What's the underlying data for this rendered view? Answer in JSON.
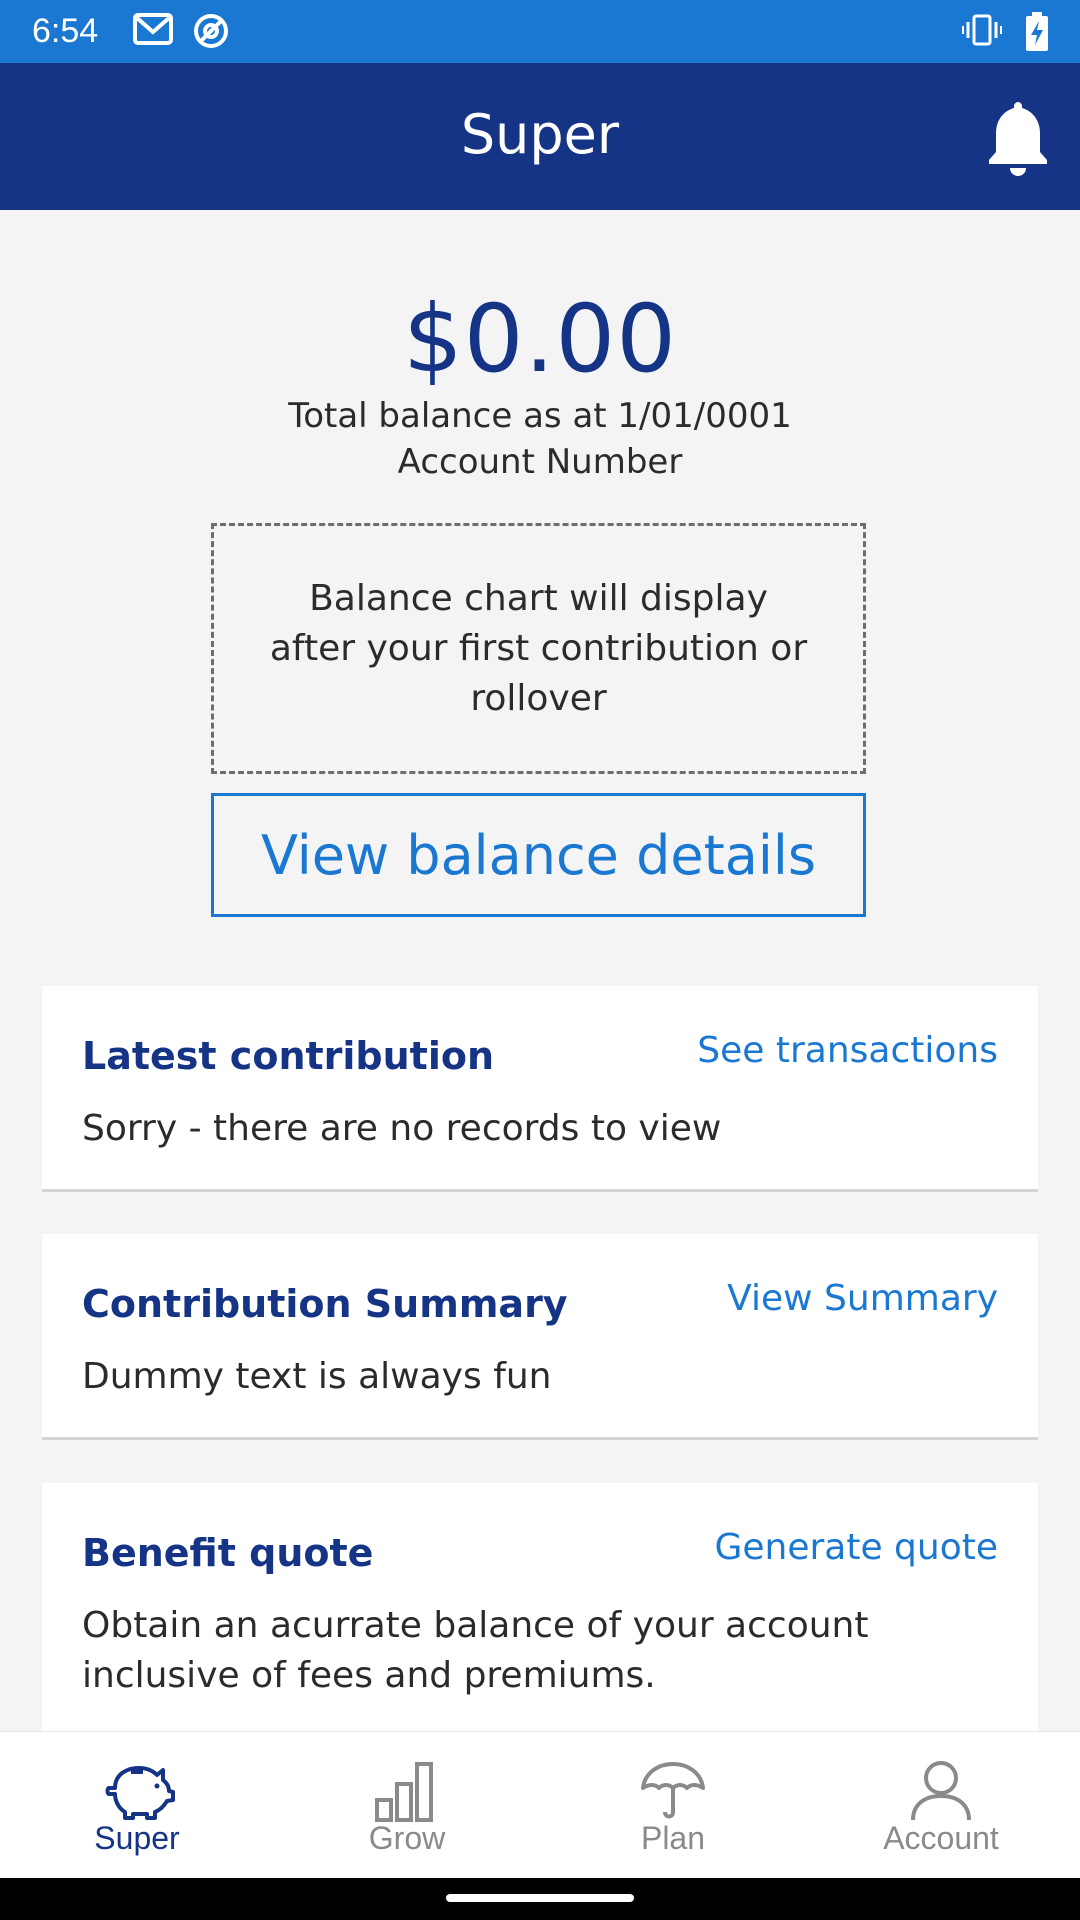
{
  "status_bar": {
    "time": "6:54",
    "icons": [
      "gmail-icon",
      "at-sign-icon",
      "vibrate-icon",
      "battery-charging-icon"
    ]
  },
  "header": {
    "title": "Super",
    "notification_icon": "bell-icon"
  },
  "balance": {
    "amount": "$0.00",
    "as_at": "Total balance as at 1/01/0001",
    "account_number_label": "Account Number"
  },
  "chart_placeholder": {
    "text": "Balance chart will display after your first contribution or rollover"
  },
  "view_balance_button": "View balance details",
  "cards": [
    {
      "title": "Latest contribution",
      "link": "See transactions",
      "body": "Sorry - there are no records to view"
    },
    {
      "title": "Contribution Summary",
      "link": "View Summary",
      "body": "Dummy text is always fun"
    },
    {
      "title": "Benefit quote",
      "link": "Generate quote",
      "body": "Obtain an acurrate balance of your account inclusive of fees and premiums."
    }
  ],
  "bottom_nav": [
    {
      "label": "Super",
      "icon": "piggy-bank-icon",
      "active": true
    },
    {
      "label": "Grow",
      "icon": "bar-chart-icon",
      "active": false
    },
    {
      "label": "Plan",
      "icon": "umbrella-icon",
      "active": false
    },
    {
      "label": "Account",
      "icon": "person-icon",
      "active": false
    }
  ],
  "colors": {
    "status_bar": "#1a78d2",
    "app_bar": "#163486",
    "accent": "#1a78d2",
    "heading": "#163486",
    "background": "#f4f4f4"
  }
}
